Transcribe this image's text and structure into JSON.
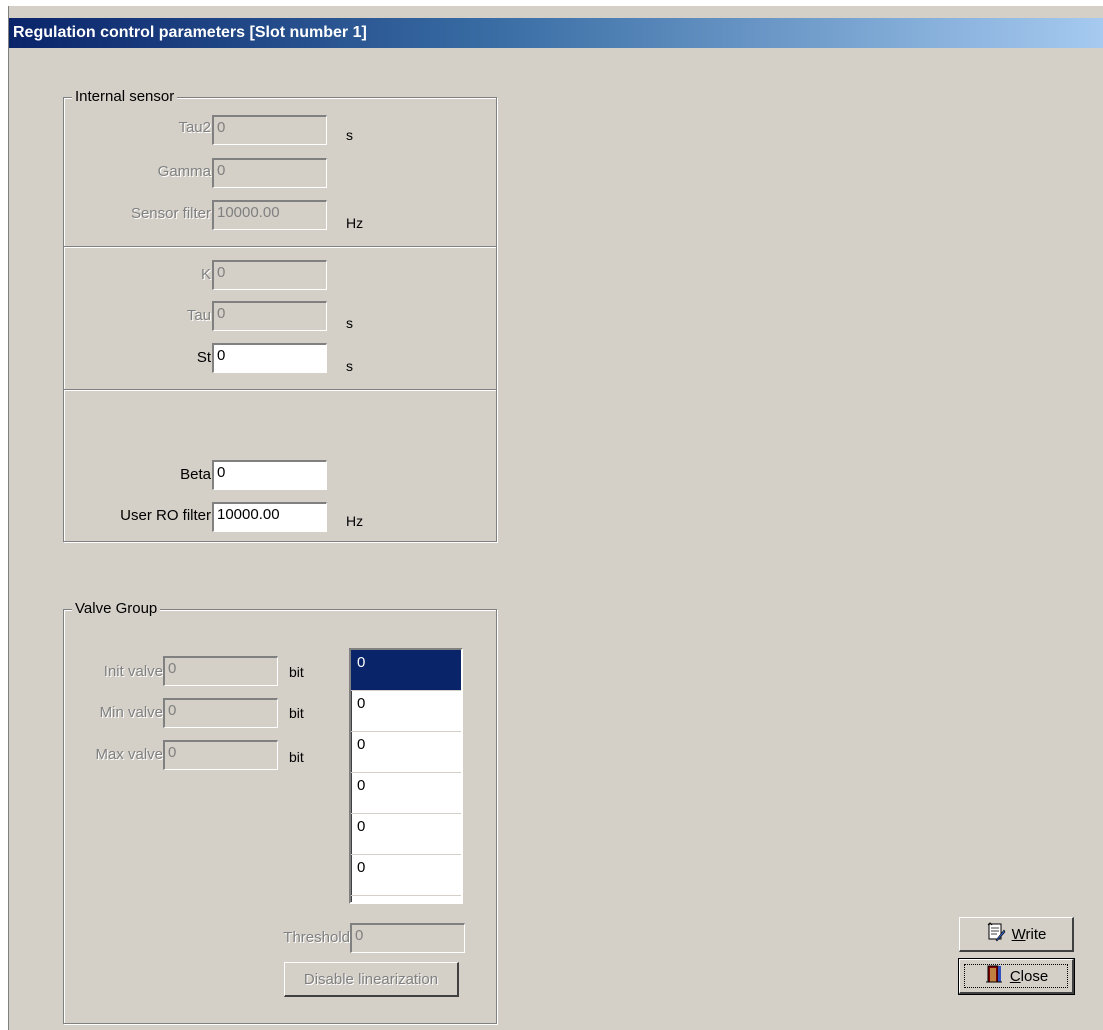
{
  "window": {
    "title": "Regulation control parameters [Slot number 1]"
  },
  "internal_sensor": {
    "legend": "Internal sensor",
    "tau2": {
      "label": "Tau2",
      "value": "0",
      "unit": "s"
    },
    "gamma": {
      "label": "Gamma",
      "value": "0"
    },
    "sensor_filter": {
      "label": "Sensor filter",
      "value": "10000.00",
      "unit": "Hz"
    },
    "k": {
      "label": "K",
      "value": "0"
    },
    "tau": {
      "label": "Tau",
      "value": "0",
      "unit": "s"
    },
    "st": {
      "label": "St",
      "value": "0",
      "unit": "s"
    },
    "beta": {
      "label": "Beta",
      "value": "0"
    },
    "user_ro_filter": {
      "label": "User RO filter",
      "value": "10000.00",
      "unit": "Hz"
    }
  },
  "valve_group": {
    "legend": "Valve Group",
    "init_valve": {
      "label": "Init valve",
      "value": "0",
      "unit": "bit"
    },
    "min_valve": {
      "label": "Min valve",
      "value": "0",
      "unit": "bit"
    },
    "max_valve": {
      "label": "Max valve",
      "value": "0",
      "unit": "bit"
    },
    "list_items": [
      "0",
      "0",
      "0",
      "0",
      "0",
      "0"
    ],
    "selected_index": 0,
    "threshold": {
      "label": "Threshold",
      "value": "0"
    },
    "disable_linearization_label": "Disable linearization"
  },
  "buttons": {
    "write_prefix": "",
    "write_mnemonic": "W",
    "write_rest": "rite",
    "close_mnemonic": "C",
    "close_rest": "lose"
  },
  "icons": {
    "write": "write-notepad-icon",
    "close": "door-exit-icon"
  },
  "colors": {
    "title_start": "#0a246a",
    "title_end": "#a6caf0",
    "selection": "#0a246a",
    "face": "#d4d0c8"
  }
}
